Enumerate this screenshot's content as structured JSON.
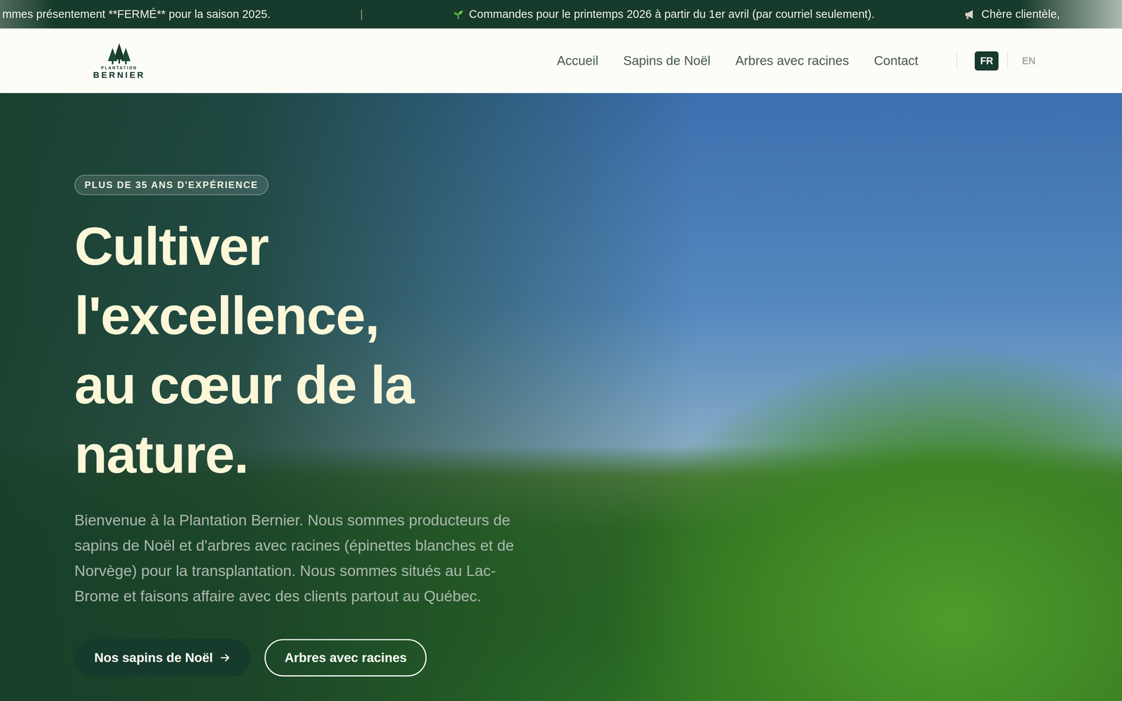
{
  "ticker": [
    {
      "text": "mmes présentement **FERMÉ** pour la saison 2025.",
      "kind": "plain"
    },
    {
      "text": "Commandes pour le printemps 2026 à partir du 1er avril (par courriel seulement).",
      "kind": "sprout"
    },
    {
      "text": "Chère clientèle,",
      "kind": "megaphone"
    }
  ],
  "ticker_separator": "|",
  "logo": {
    "top": "PLANTATION",
    "name": "BERNIER"
  },
  "nav": [
    {
      "label": "Accueil"
    },
    {
      "label": "Sapins de Noël"
    },
    {
      "label": "Arbres avec racines"
    },
    {
      "label": "Contact"
    }
  ],
  "languages": [
    {
      "label": "FR",
      "selected": true
    },
    {
      "label": "EN",
      "selected": false
    }
  ],
  "hero": {
    "badge": "PLUS DE 35 ANS D'EXPÉRIENCE",
    "heading_lines": [
      "Cultiver",
      "l'excellence,",
      "au cœur de la",
      "nature."
    ],
    "text": "Bienvenue à la Plantation Bernier. Nous sommes producteurs de sapins de Noël et d'arbres avec racines (épinettes blanches et de Norvège) pour la transplantation. Nous sommes situés au Lac-Brome et faisons affaire avec des clients partout au Québec.",
    "buttons": [
      {
        "label": "Nos sapins de Noël",
        "kind": "primary"
      },
      {
        "label": "Arbres avec racines",
        "kind": "outline"
      }
    ]
  }
}
